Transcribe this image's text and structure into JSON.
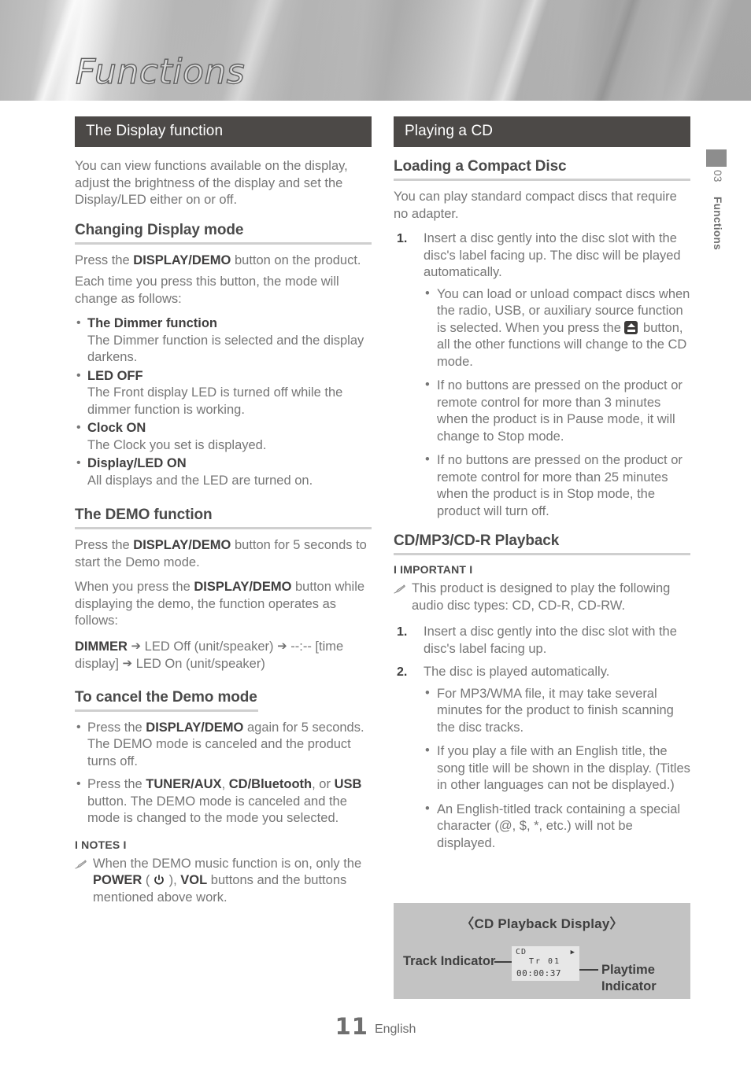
{
  "banner": {
    "chapter_title": "Functions"
  },
  "side_tab": {
    "number": "03",
    "label": "Functions"
  },
  "left_column": {
    "section_bar": "The Display function",
    "intro": "You can view functions available on the display, adjust the brightness of the display and set the Display/LED either on or off.",
    "sub1": {
      "heading": "Changing Display mode",
      "p1_pre": "Press the ",
      "p1_bold": "DISPLAY/DEMO",
      "p1_post": " button on the product.",
      "p2": "Each time you press this button, the mode will change as follows:",
      "bullets": [
        {
          "head": "The Dimmer function",
          "text": "The Dimmer function is selected and the display darkens."
        },
        {
          "head": "LED OFF",
          "text": "The Front display LED is turned off while the dimmer function is working."
        },
        {
          "head": "Clock ON",
          "text": "The Clock you set is displayed."
        },
        {
          "head": "Display/LED ON",
          "text": "All displays and the LED are turned on."
        }
      ]
    },
    "sub2": {
      "heading": "The DEMO function",
      "p1_pre": "Press the ",
      "p1_bold": "DISPLAY/DEMO",
      "p1_post": " button for 5 seconds to start the Demo mode.",
      "p2_pre": "When you press the ",
      "p2_bold": "DISPLAY/DEMO",
      "p2_post": " button while displaying the demo, the function operates as follows:",
      "flow_bold": "DIMMER",
      "flow_rest_1": " LED Off (unit/speaker) ",
      "flow_rest_2": " --:-- [time display] ",
      "flow_rest_3": " LED On (unit/speaker)",
      "arrow": "➔"
    },
    "sub3": {
      "heading": "To cancel the Demo mode",
      "bullets": [
        {
          "pre": "Press the ",
          "bold": "DISPLAY/DEMO",
          "post": " again for 5 seconds. The DEMO mode is canceled and the product turns off."
        },
        {
          "pre": "Press the ",
          "bold1": "TUNER/AUX",
          "mid1": ", ",
          "bold2": "CD/Bluetooth",
          "mid2": ", or ",
          "bold3": "USB",
          "post": " button. The DEMO mode is canceled and the mode is changed to the mode you selected."
        }
      ]
    },
    "notes": {
      "title": "I NOTES I",
      "icon": "pencil-icon",
      "pre": "When the DEMO music function is on, only the ",
      "bold1": "POWER",
      "mid": " ( ",
      "power_icon": "power-icon",
      "mid2": " ), ",
      "bold2": "VOL",
      "post": " buttons and the buttons mentioned above work."
    }
  },
  "right_column": {
    "section_bar": "Playing a CD",
    "sub1": {
      "heading": "Loading a Compact Disc",
      "intro": "You can play standard compact discs that require no adapter.",
      "item1": "Insert a disc gently into the disc slot with the disc's label facing up. The disc will be played automatically.",
      "sub_bullets": [
        {
          "pre": "You can load or unload compact discs when the radio, USB, or auxiliary source function is selected. When you press the ",
          "icon": "eject-icon",
          "post": " button, all the other functions will change to the CD mode."
        },
        {
          "text": "If no buttons are pressed on the product or remote control for more than 3 minutes when the product is in Pause mode, it will change to Stop mode."
        },
        {
          "text": "If no buttons are pressed on the product or remote control for more than 25 minutes when the product is in Stop mode, the product will turn off."
        }
      ]
    },
    "sub2": {
      "heading": "CD/MP3/CD-R Playback",
      "important_title": "I IMPORTANT I",
      "important_icon": "pencil-icon",
      "important_text": "This product is designed to play the following audio disc types: CD, CD-R, CD-RW.",
      "item1": "Insert a disc gently into the disc slot with the disc's label facing up.",
      "item2": "The disc is played automatically.",
      "item2_bullets": [
        "For MP3/WMA file, it may take several minutes for the product to finish scanning the disc tracks.",
        "If you play a file with an English title, the song title will be shown in the display. (Titles in other languages can not be displayed.)",
        "An English-titled track containing a special character (@, $, *, etc.) will not be displayed."
      ]
    }
  },
  "figure": {
    "title": "〈CD Playback Display〉",
    "label_track": "Track Indicator",
    "label_playtime_line1": "Playtime",
    "label_playtime_line2": "Indicator",
    "lcd": {
      "source": "CD",
      "play_icon": "▶",
      "track": "Tr 01",
      "time": "00:00:37"
    }
  },
  "footer": {
    "page_number": "11",
    "language": "English"
  },
  "colors": {
    "bar_background": "#4c4947",
    "heading_text": "#4a4a4a",
    "body_text": "#767676",
    "rule": "#cfcfcf",
    "figure_background": "#c3c3c3",
    "lcd_background": "#e7e7e7"
  }
}
